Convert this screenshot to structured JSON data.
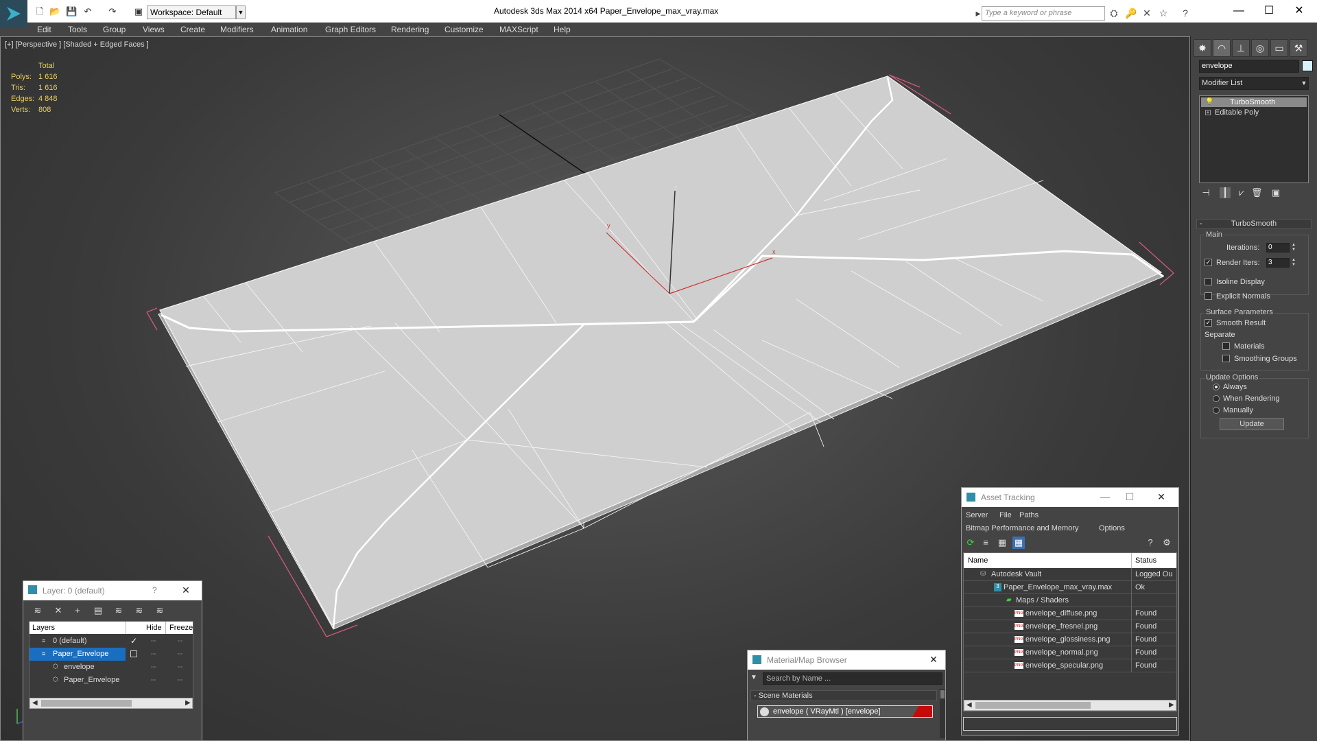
{
  "window": {
    "title": "Autodesk 3ds Max  2014 x64      Paper_Envelope_max_vray.max",
    "workspace": "Workspace: Default",
    "search_placeholder": "Type a keyword or phrase"
  },
  "menu": [
    "Edit",
    "Tools",
    "Group",
    "Views",
    "Create",
    "Modifiers",
    "Animation",
    "Graph Editors",
    "Rendering",
    "Customize",
    "MAXScript",
    "Help"
  ],
  "viewport": {
    "label": "[+] [Perspective ] [Shaded + Edged Faces ]",
    "stats": {
      "header": "Total",
      "rows": [
        {
          "label": "Polys:",
          "value": "1 616"
        },
        {
          "label": "Tris:",
          "value": "1 616"
        },
        {
          "label": "Edges:",
          "value": "4 848"
        },
        {
          "label": "Verts:",
          "value": "808"
        }
      ]
    },
    "axis_labels": {
      "z": "z",
      "y": "y",
      "x": "x"
    }
  },
  "command_panel": {
    "object_name": "envelope",
    "modifier_list": "Modifier List",
    "stack": [
      {
        "label": "TurboSmooth",
        "selected": true
      },
      {
        "label": "Editable Poly",
        "selected": false
      }
    ],
    "rollout_title": "TurboSmooth",
    "main": {
      "label": "Main",
      "iterations_label": "Iterations:",
      "iterations_value": "0",
      "render_iters_label": "Render Iters:",
      "render_iters_value": "3",
      "isoline": "Isoline Display",
      "explicit_normals": "Explicit Normals"
    },
    "surface": {
      "label": "Surface Parameters",
      "smooth_result": "Smooth Result",
      "separate": "Separate",
      "materials": "Materials",
      "smoothing_groups": "Smoothing Groups"
    },
    "update_options": {
      "label": "Update Options",
      "always": "Always",
      "when_rendering": "When Rendering",
      "manually": "Manually",
      "update_button": "Update"
    }
  },
  "layer_window": {
    "title": "Layer: 0 (default)",
    "help": "?",
    "columns": [
      "Layers",
      "Hide",
      "Freeze"
    ],
    "rows": [
      {
        "name": "0 (default)",
        "indent": 1
      },
      {
        "name": "Paper_Envelope",
        "indent": 1
      },
      {
        "name": "envelope",
        "indent": 2
      },
      {
        "name": "Paper_Envelope",
        "indent": 2
      }
    ]
  },
  "material_browser": {
    "title": "Material/Map Browser",
    "search_placeholder": "Search by Name ...",
    "section": "- Scene Materials",
    "item": "envelope  ( VRayMtl )  [envelope]"
  },
  "asset_tracking": {
    "title": "Asset Tracking",
    "menu": [
      "Server",
      "File",
      "Paths"
    ],
    "menu2": [
      "Bitmap Performance and Memory",
      "Options"
    ],
    "columns": [
      "Name",
      "Status"
    ],
    "rows": [
      {
        "name": "Autodesk Vault",
        "status": "Logged Ou",
        "indent": 1
      },
      {
        "name": "Paper_Envelope_max_vray.max",
        "status": "Ok",
        "indent": 2
      },
      {
        "name": "Maps / Shaders",
        "status": "",
        "indent": 3
      },
      {
        "name": "envelope_diffuse.png",
        "status": "Found",
        "indent": 4
      },
      {
        "name": "envelope_fresnel.png",
        "status": "Found",
        "indent": 4
      },
      {
        "name": "envelope_glossiness.png",
        "status": "Found",
        "indent": 4
      },
      {
        "name": "envelope_normal.png",
        "status": "Found",
        "indent": 4
      },
      {
        "name": "envelope_specular.png",
        "status": "Found",
        "indent": 4
      }
    ]
  }
}
